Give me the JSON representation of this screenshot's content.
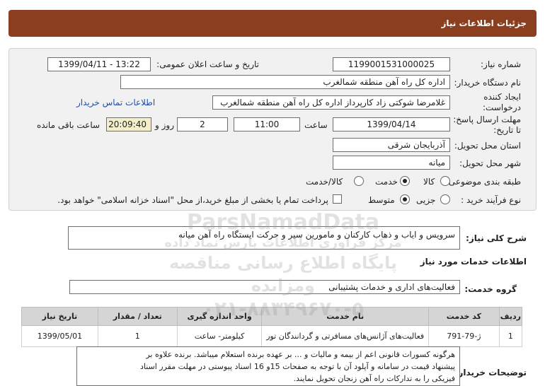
{
  "header": {
    "title": "جزئیات اطلاعات نیاز"
  },
  "form": {
    "need_number_label": "شماره نیاز:",
    "need_number": "1199001531000025",
    "announce_label": "تاریخ و ساعت اعلان عمومی:",
    "announce_value": "1399/04/11 - 13:22",
    "buyer_label": "نام دستگاه خریدار:",
    "buyer_value": "اداره کل راه آهن منطقه شمالغرب",
    "creator_label": "ایجاد کننده درخواست:",
    "creator_value": "غلامرضا شوکتی زاد کارپرداز اداره کل راه آهن منطقه شمالغرب",
    "contact_link": "اطلاعات تماس خریدار",
    "deadline_label": "مهلت ارسال پاسخ: تا تاریخ:",
    "deadline_date": "1399/04/14",
    "time_label": "ساعت",
    "deadline_time": "11:00",
    "days_value": "2",
    "days_label": "روز و",
    "remaining_value": "20:09:40",
    "remaining_label": "ساعت باقی مانده",
    "province_label": "استان محل تحویل:",
    "province_value": "آذربایجان شرقی",
    "city_label": "شهر محل تحویل:",
    "city_value": "میانه",
    "category_label": "طبقه بندی موضوعی:",
    "category_options": [
      "کالا",
      "خدمت",
      "کالا/خدمت"
    ],
    "process_label": "نوع فرآیند خرید :",
    "process_options": [
      "جزیی",
      "متوسط"
    ],
    "payment_note": "پرداخت تمام یا بخشی از مبلغ خرید،از محل \"اسناد خزانه اسلامی\" خواهد بود."
  },
  "summary": {
    "label": "شرح کلی نیاز:",
    "value": "سرویس و ایاب و ذهاب کارکنان و مامورین سیر و حرکت ایستگاه راه آهن میانه"
  },
  "services": {
    "title": "اطلاعات خدمات مورد نیاز",
    "group_label": "گروه خدمت:",
    "group_value": "فعالیت‌های اداری و خدمات پشتیبانی"
  },
  "table": {
    "headers": [
      "ردیف",
      "کد خدمت",
      "نام خدمت",
      "واحد اندازه گیری",
      "تعداد / مقدار",
      "تاریخ نیاز"
    ],
    "rows": [
      [
        "1",
        "ژ-79-791",
        "فعالیت‌های آژانس‌های مسافرتی و گردانندگان تور",
        "کیلومتر- ساعت",
        "1",
        "1399/05/01"
      ]
    ]
  },
  "buyer_notes": {
    "label": "توضیحات خریدار:",
    "line1": "هرگونه کسورات قانونی اعم از بیمه و مالیات و ... بر عهده برنده استعلام میباشد. برنده علاوه بر",
    "line2": "پیشنهاد قیمت در سامانه و آپلود آن با توجه به صفحات 15و 16 اسناد پیوستی در مهلت مقرر اسناد",
    "line3": "فیزیکی را به تدارکات راه آهن زنجان تحویل نمایند."
  },
  "watermark": {
    "line1": "ParsNamadData",
    "line2": "مرکز فراوری اطلاعات پارس نماد داده",
    "line3": "پایگاه اطلاع رسانی مناقصه ومزایده",
    "line4": "۰۲۱-۸۸۳۴۹۶۷۰-۵"
  }
}
